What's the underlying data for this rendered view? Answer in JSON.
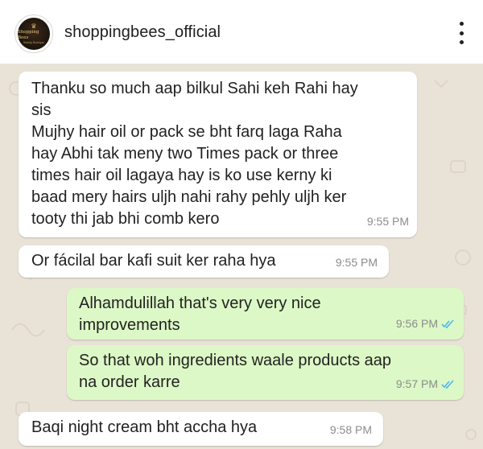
{
  "header": {
    "account_name": "shoppingbees_official",
    "avatar": {
      "brand": "Shopping Bees",
      "sub": "Beauty Boutique",
      "icon": "crown-icon"
    },
    "more_icon": "vertical-dots-icon"
  },
  "colors": {
    "chat_background": "#e9e2d6",
    "incoming_bubble": "#ffffff",
    "outgoing_bubble": "#dcf8c6",
    "read_ticks": "#4fb6ec",
    "time_text": "#8c8c8c"
  },
  "messages": [
    {
      "direction": "incoming",
      "lines": [
        "Thanku so much aap bilkul Sahi keh Rahi hay",
        "sis",
        "Mujhy hair oil or pack se bht farq laga Raha",
        "hay Abhi tak meny two Times pack or three",
        "times hair oil lagaya hay is ko use kerny ki",
        "baad mery hairs uljh nahi rahy pehly uljh ker",
        "tooty thi jab bhi comb kero"
      ],
      "time": "9:55 PM"
    },
    {
      "direction": "incoming",
      "lines": [
        "Or fácilal bar kafi suit ker raha hya"
      ],
      "time": "9:55 PM"
    },
    {
      "direction": "outgoing",
      "lines": [
        "Alhamdulillah that's very very nice",
        "improvements"
      ],
      "time": "9:56 PM",
      "status": "read"
    },
    {
      "direction": "outgoing",
      "lines": [
        "So that woh ingredients waale products aap",
        "na order karre"
      ],
      "time": "9:57 PM",
      "status": "read"
    },
    {
      "direction": "incoming",
      "lines": [
        "Baqi night cream bht accha hya"
      ],
      "time": "9:58 PM"
    }
  ]
}
